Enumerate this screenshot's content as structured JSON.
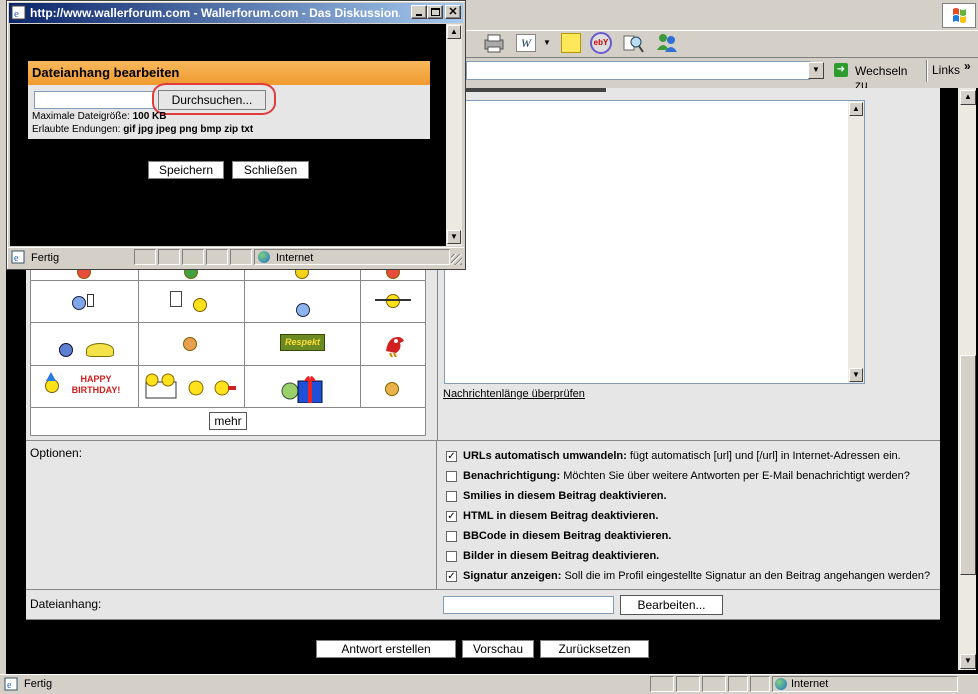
{
  "popup": {
    "title": "http://www.wallerforum.com - Wallerforum.com - Das Diskussion...",
    "panel_header": "Dateianhang bearbeiten",
    "browse_label": "Durchsuchen...",
    "max_size_label": "Maximale Dateigröße:",
    "max_size_value": "100 KB",
    "allowed_label": "Erlaubte Endungen:",
    "allowed_value": "gif jpg jpeg png bmp zip txt",
    "save_label": "Speichern",
    "close_label": "Schließen",
    "status_text": "Fertig",
    "zone_text": "Internet"
  },
  "browser": {
    "go_label": "Wechseln zu",
    "links_label": "Links",
    "status_text": "Fertig",
    "zone_text": "Internet"
  },
  "main": {
    "more_label": "mehr",
    "check_length_label": "Nachrichtenlänge überprüfen",
    "options_label": "Optionen:",
    "attachment_label": "Dateianhang:",
    "edit_label": "Bearbeiten...",
    "birthday_text": "HAPPY BIRTHDAY!",
    "respekt_text": "Respekt",
    "options": [
      {
        "bold": "URLs automatisch umwandeln:",
        "text": " fügt automatisch [url] und [/url] in Internet-Adressen ein.",
        "checked": true
      },
      {
        "bold": "Benachrichtigung:",
        "text": " Möchten Sie über weitere Antworten per E-Mail benachrichtigt werden?",
        "checked": false
      },
      {
        "bold": "Smilies in diesem Beitrag deaktivieren.",
        "text": "",
        "checked": false
      },
      {
        "bold": "HTML in diesem Beitrag deaktivieren.",
        "text": "",
        "checked": true
      },
      {
        "bold": "BBCode in diesem Beitrag deaktivieren.",
        "text": "",
        "checked": false
      },
      {
        "bold": "Bilder in diesem Beitrag deaktivieren.",
        "text": "",
        "checked": false
      },
      {
        "bold": "Signatur anzeigen:",
        "text": " Soll die im Profil eingestellte Signatur an den Beitrag angehangen werden?",
        "checked": true
      }
    ],
    "submit_label": "Antwort erstellen",
    "preview_label": "Vorschau",
    "reset_label": "Zurücksetzen"
  }
}
